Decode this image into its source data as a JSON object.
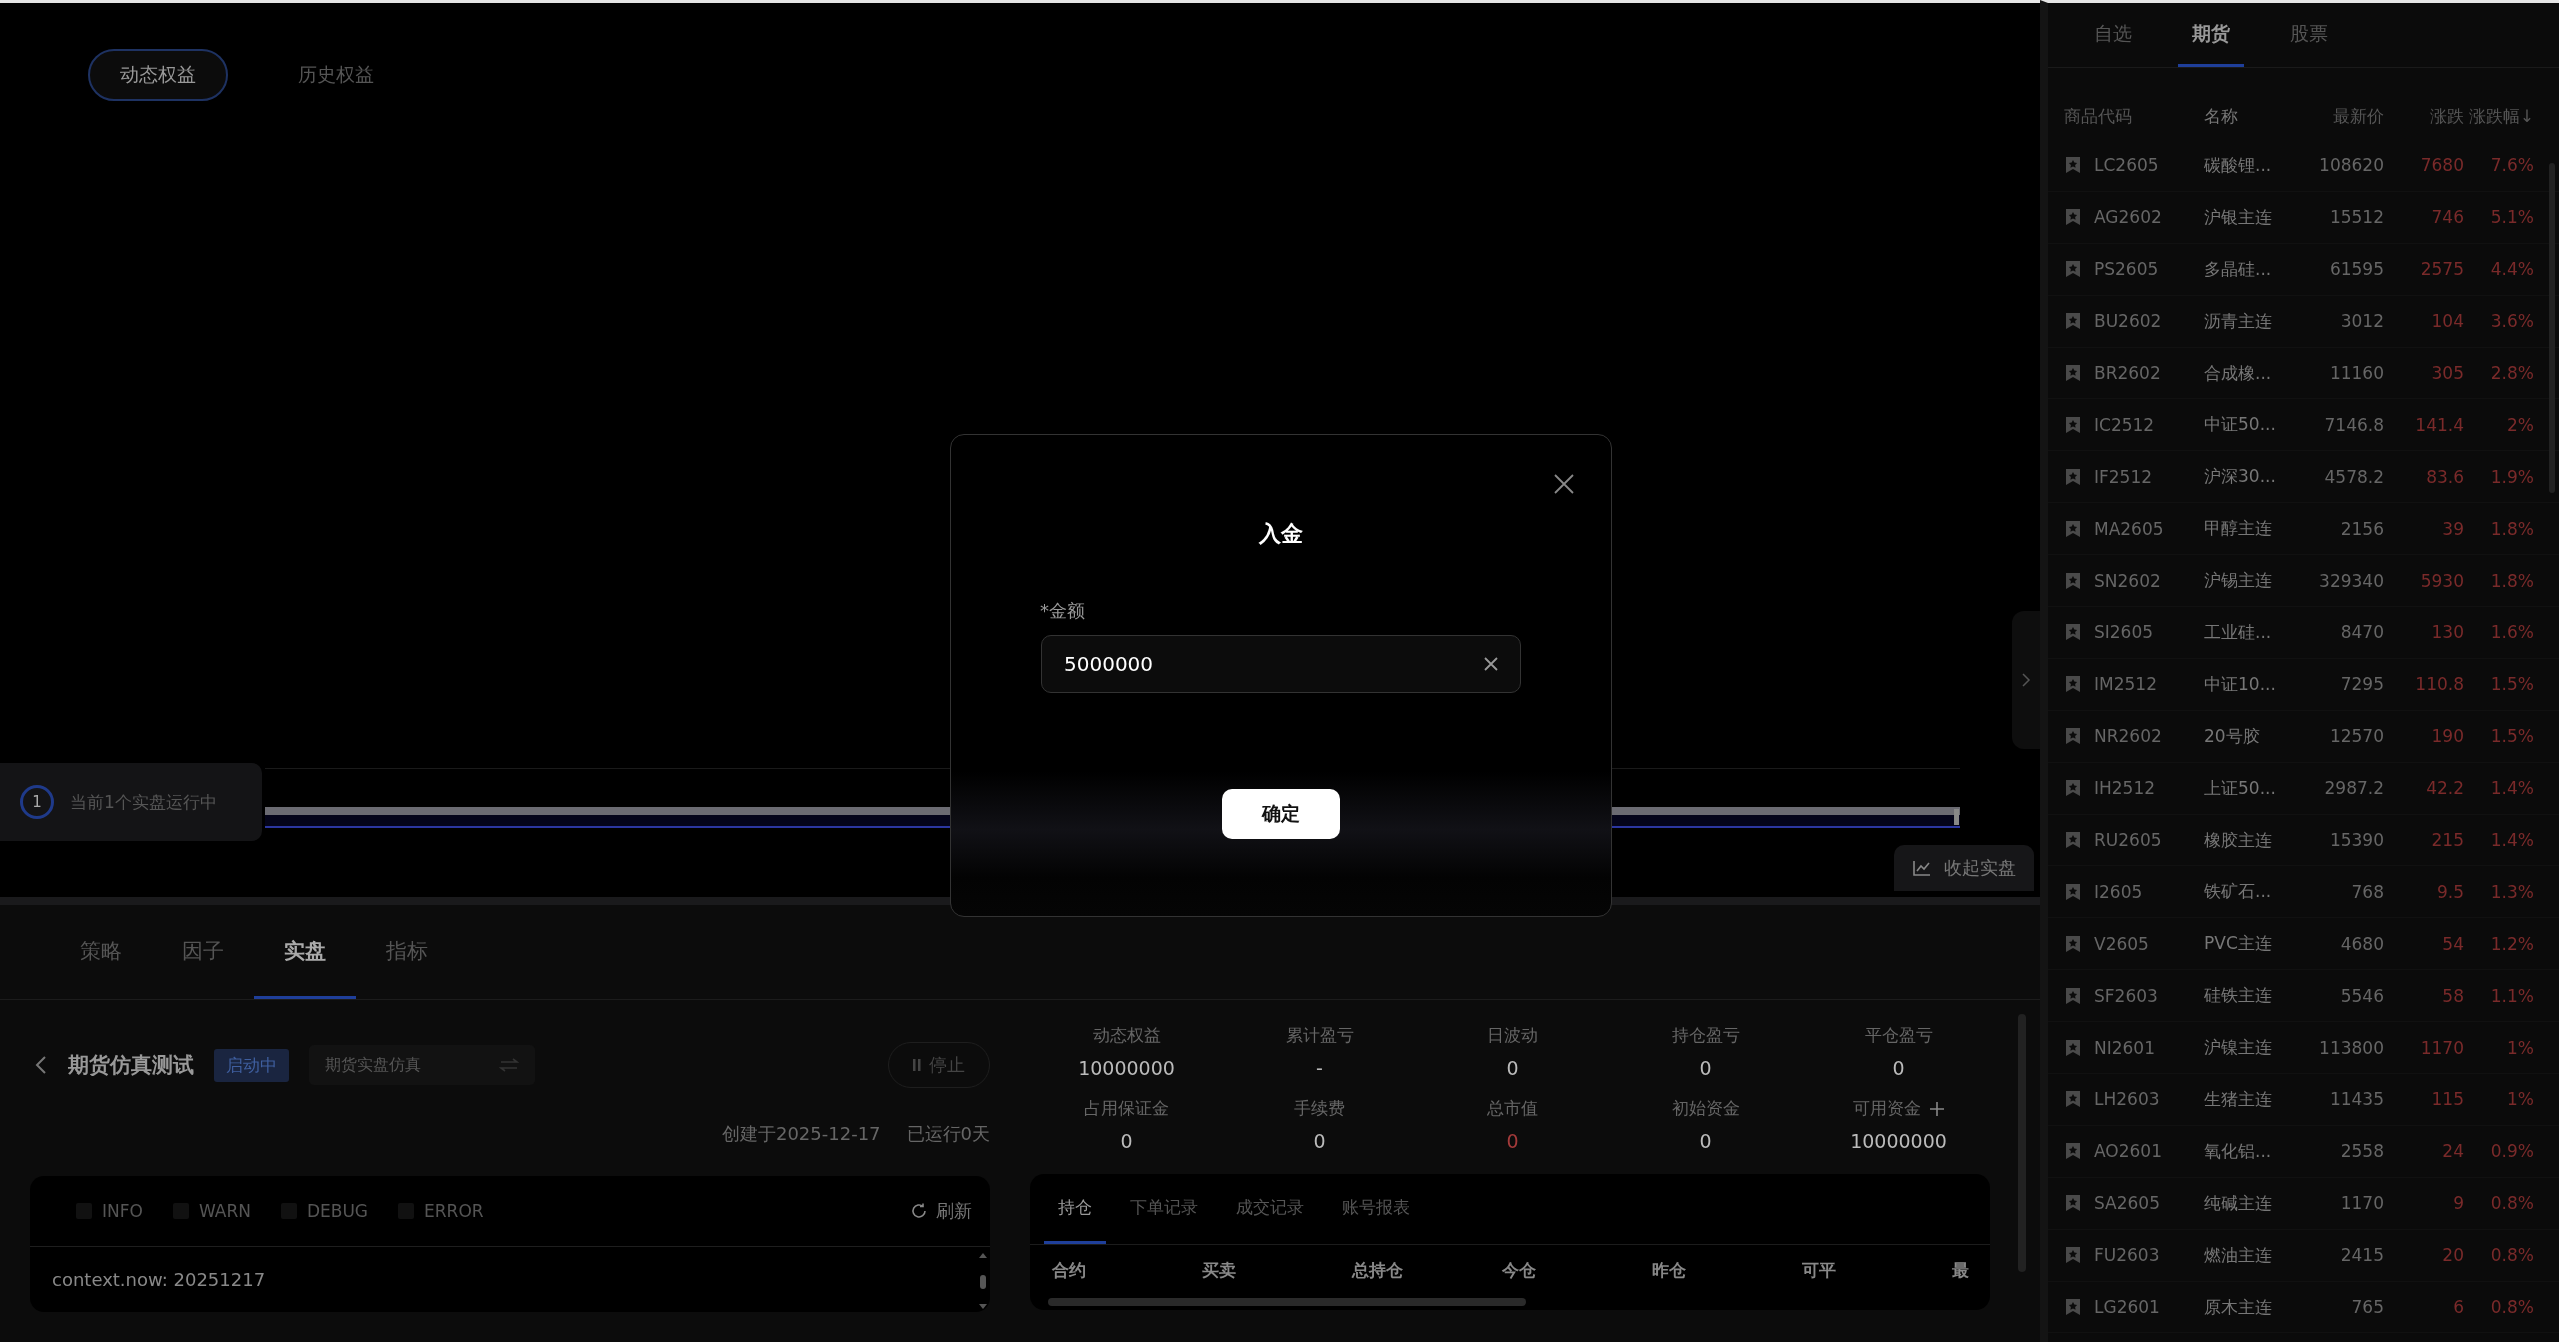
{
  "equity_tabs": [
    {
      "label": "动态权益",
      "selected": true
    },
    {
      "label": "历史权益",
      "selected": false
    }
  ],
  "running_badge": {
    "count": "1",
    "text": "当前1个实盘运行中"
  },
  "collapse_button": "收起实盘",
  "zoom_slider": {
    "level": 1
  },
  "bottom_tabs": [
    {
      "label": "策略",
      "selected": false
    },
    {
      "label": "因子",
      "selected": false
    },
    {
      "label": "实盘",
      "selected": true
    },
    {
      "label": "指标",
      "selected": false
    }
  ],
  "strategy": {
    "title": "期货仿真测试",
    "status": "启动中",
    "mode": "期货实盘仿真",
    "stop_button": "停止",
    "created": "创建于2025-12-17",
    "runtime": "已运行0天"
  },
  "log": {
    "levels": [
      {
        "label": "INFO",
        "checked": false
      },
      {
        "label": "WARN",
        "checked": false
      },
      {
        "label": "DEBUG",
        "checked": false
      },
      {
        "label": "ERROR",
        "checked": false
      }
    ],
    "refresh": "刷新",
    "lines": [
      "context.now: 20251217"
    ]
  },
  "stats": [
    {
      "label": "动态权益",
      "value": "10000000",
      "kind": "plain",
      "addable": false
    },
    {
      "label": "累计盈亏",
      "value": "-",
      "kind": "plain",
      "addable": false
    },
    {
      "label": "日波动",
      "value": "0",
      "kind": "plain",
      "addable": false
    },
    {
      "label": "持仓盈亏",
      "value": "0",
      "kind": "plain",
      "addable": false
    },
    {
      "label": "平仓盈亏",
      "value": "0",
      "kind": "plain",
      "addable": false
    },
    {
      "label": "占用保证金",
      "value": "0",
      "kind": "plain",
      "addable": false
    },
    {
      "label": "手续费",
      "value": "0",
      "kind": "plain",
      "addable": false
    },
    {
      "label": "总市值",
      "value": "0",
      "kind": "red",
      "addable": false
    },
    {
      "label": "初始资金",
      "value": "0",
      "kind": "plain",
      "addable": false
    },
    {
      "label": "可用资金",
      "value": "10000000",
      "kind": "plain",
      "addable": true
    }
  ],
  "positions": {
    "tabs": [
      {
        "label": "持仓",
        "selected": true
      },
      {
        "label": "下单记录",
        "selected": false
      },
      {
        "label": "成交记录",
        "selected": false
      },
      {
        "label": "账号报表",
        "selected": false
      }
    ],
    "columns": [
      "合约",
      "买卖",
      "总持仓",
      "今仓",
      "昨仓",
      "可平",
      "最"
    ]
  },
  "modal": {
    "title": "入金",
    "field_label": "*金额",
    "value": "5000000",
    "confirm": "确定"
  },
  "market": {
    "tabs": [
      {
        "label": "自选",
        "selected": false
      },
      {
        "label": "期货",
        "selected": true
      },
      {
        "label": "股票",
        "selected": false
      }
    ],
    "columns": [
      "商品代码",
      "名称",
      "最新价",
      "涨跌",
      "涨跌幅↓"
    ],
    "rows": [
      {
        "code": "LC2605",
        "name": "碳酸锂...",
        "price": "108620",
        "change": "7680",
        "pct": "7.6%"
      },
      {
        "code": "AG2602",
        "name": "沪银主连",
        "price": "15512",
        "change": "746",
        "pct": "5.1%"
      },
      {
        "code": "PS2605",
        "name": "多晶硅...",
        "price": "61595",
        "change": "2575",
        "pct": "4.4%"
      },
      {
        "code": "BU2602",
        "name": "沥青主连",
        "price": "3012",
        "change": "104",
        "pct": "3.6%"
      },
      {
        "code": "BR2602",
        "name": "合成橡...",
        "price": "11160",
        "change": "305",
        "pct": "2.8%"
      },
      {
        "code": "IC2512",
        "name": "中证50...",
        "price": "7146.8",
        "change": "141.4",
        "pct": "2%"
      },
      {
        "code": "IF2512",
        "name": "沪深30...",
        "price": "4578.2",
        "change": "83.6",
        "pct": "1.9%"
      },
      {
        "code": "MA2605",
        "name": "甲醇主连",
        "price": "2156",
        "change": "39",
        "pct": "1.8%"
      },
      {
        "code": "SN2602",
        "name": "沪锡主连",
        "price": "329340",
        "change": "5930",
        "pct": "1.8%"
      },
      {
        "code": "SI2605",
        "name": "工业硅...",
        "price": "8470",
        "change": "130",
        "pct": "1.6%"
      },
      {
        "code": "IM2512",
        "name": "中证10...",
        "price": "7295",
        "change": "110.8",
        "pct": "1.5%"
      },
      {
        "code": "NR2602",
        "name": "20号胶",
        "price": "12570",
        "change": "190",
        "pct": "1.5%"
      },
      {
        "code": "IH2512",
        "name": "上证50...",
        "price": "2987.2",
        "change": "42.2",
        "pct": "1.4%"
      },
      {
        "code": "RU2605",
        "name": "橡胶主连",
        "price": "15390",
        "change": "215",
        "pct": "1.4%"
      },
      {
        "code": "I2605",
        "name": "铁矿石...",
        "price": "768",
        "change": "9.5",
        "pct": "1.3%"
      },
      {
        "code": "V2605",
        "name": "PVC主连",
        "price": "4680",
        "change": "54",
        "pct": "1.2%"
      },
      {
        "code": "SF2603",
        "name": "硅铁主连",
        "price": "5546",
        "change": "58",
        "pct": "1.1%"
      },
      {
        "code": "NI2601",
        "name": "沪镍主连",
        "price": "113800",
        "change": "1170",
        "pct": "1%"
      },
      {
        "code": "LH2603",
        "name": "生猪主连",
        "price": "11435",
        "change": "115",
        "pct": "1%"
      },
      {
        "code": "AO2601",
        "name": "氧化铝...",
        "price": "2558",
        "change": "24",
        "pct": "0.9%"
      },
      {
        "code": "SA2605",
        "name": "纯碱主连",
        "price": "1170",
        "change": "9",
        "pct": "0.8%"
      },
      {
        "code": "FU2603",
        "name": "燃油主连",
        "price": "2415",
        "change": "20",
        "pct": "0.8%"
      },
      {
        "code": "LG2601",
        "name": "原木主连",
        "price": "765",
        "change": "6",
        "pct": "0.8%"
      }
    ]
  }
}
